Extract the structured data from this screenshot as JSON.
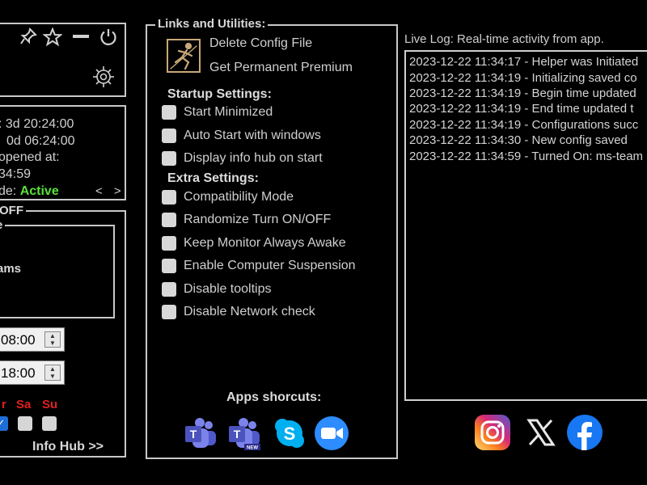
{
  "window": {
    "toolbar_icons": [
      "pin-icon",
      "star-icon",
      "minimize-icon",
      "power-icon",
      "gear-icon"
    ]
  },
  "status": {
    "line1": ": 3d 20:24:00",
    "line2": "0d 06:24:00",
    "line3": "opened at:",
    "line4": "34:59",
    "mode_prefix": "de:",
    "mode_value": "Active",
    "nav": "< >"
  },
  "settings_panel": {
    "legend": "OFF",
    "inner_legend": "e",
    "app_text": "ams",
    "time_start": "08:00",
    "time_end": "18:00",
    "days": [
      "r",
      "Sa",
      "Su"
    ],
    "day_checked": [
      true,
      false,
      false
    ],
    "info_hub": "Info Hub >>"
  },
  "links": {
    "legend": "Links and Utilities:",
    "delete_config": "Delete Config File",
    "get_premium": "Get Permanent Premium"
  },
  "startup": {
    "heading": "Startup Settings:",
    "items": [
      {
        "label": "Start Minimized",
        "checked": false
      },
      {
        "label": "Auto Start with windows",
        "checked": false
      },
      {
        "label": "Display info hub on start",
        "checked": false
      }
    ]
  },
  "extra": {
    "heading": "Extra Settings:",
    "items": [
      {
        "label": "Compatibility Mode",
        "checked": false
      },
      {
        "label": "Randomize Turn ON/OFF",
        "checked": false
      },
      {
        "label": "Keep Monitor Always Awake",
        "checked": false
      },
      {
        "label": "Enable Computer Suspension",
        "checked": false
      },
      {
        "label": "Disable tooltips",
        "checked": false
      },
      {
        "label": "Disable Network check",
        "checked": false
      }
    ]
  },
  "apps": {
    "heading": "Apps shorcuts:",
    "new_badge": "NEW",
    "icons": [
      "teams-icon",
      "teams-new-icon",
      "skype-icon",
      "zoom-icon"
    ]
  },
  "log": {
    "title": "Live Log: Real-time activity from app.",
    "lines": [
      "2023-12-22 11:34:17 - Helper was Initiated",
      "2023-12-22 11:34:19 - Initializing saved co",
      "2023-12-22 11:34:19 - Begin time updated",
      "2023-12-22 11:34:19 - End time updated t",
      "2023-12-22 11:34:19 - Configurations succ",
      "2023-12-22 11:34:30 - New config saved",
      "2023-12-22 11:34:59 - Turned On: ms-team"
    ]
  },
  "social": {
    "icons": [
      "instagram-icon",
      "x-icon",
      "facebook-icon"
    ]
  },
  "colors": {
    "background": "#000000",
    "text": "#c8c8c8",
    "active": "#58e23a",
    "weekend": "#e02020",
    "checkbox_checked": "#1e6ed8"
  }
}
